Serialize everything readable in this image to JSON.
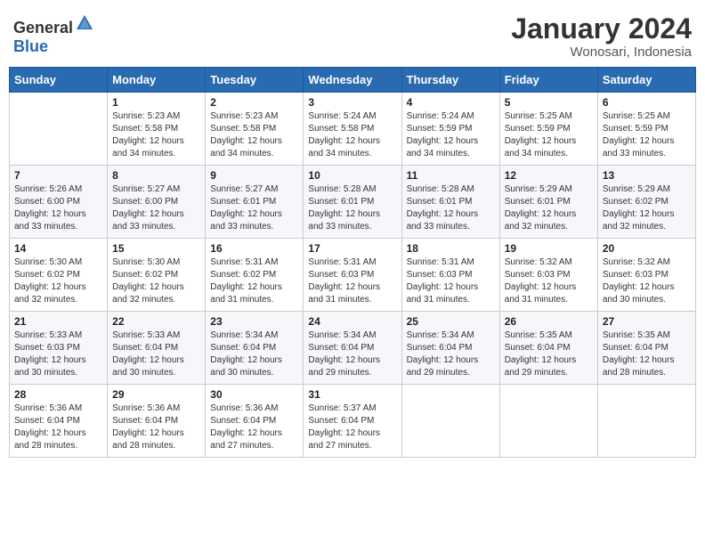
{
  "header": {
    "logo_general": "General",
    "logo_blue": "Blue",
    "month_title": "January 2024",
    "location": "Wonosari, Indonesia"
  },
  "days_of_week": [
    "Sunday",
    "Monday",
    "Tuesday",
    "Wednesday",
    "Thursday",
    "Friday",
    "Saturday"
  ],
  "weeks": [
    [
      {
        "day": "",
        "info": ""
      },
      {
        "day": "1",
        "info": "Sunrise: 5:23 AM\nSunset: 5:58 PM\nDaylight: 12 hours\nand 34 minutes."
      },
      {
        "day": "2",
        "info": "Sunrise: 5:23 AM\nSunset: 5:58 PM\nDaylight: 12 hours\nand 34 minutes."
      },
      {
        "day": "3",
        "info": "Sunrise: 5:24 AM\nSunset: 5:58 PM\nDaylight: 12 hours\nand 34 minutes."
      },
      {
        "day": "4",
        "info": "Sunrise: 5:24 AM\nSunset: 5:59 PM\nDaylight: 12 hours\nand 34 minutes."
      },
      {
        "day": "5",
        "info": "Sunrise: 5:25 AM\nSunset: 5:59 PM\nDaylight: 12 hours\nand 34 minutes."
      },
      {
        "day": "6",
        "info": "Sunrise: 5:25 AM\nSunset: 5:59 PM\nDaylight: 12 hours\nand 33 minutes."
      }
    ],
    [
      {
        "day": "7",
        "info": "Sunrise: 5:26 AM\nSunset: 6:00 PM\nDaylight: 12 hours\nand 33 minutes."
      },
      {
        "day": "8",
        "info": "Sunrise: 5:27 AM\nSunset: 6:00 PM\nDaylight: 12 hours\nand 33 minutes."
      },
      {
        "day": "9",
        "info": "Sunrise: 5:27 AM\nSunset: 6:01 PM\nDaylight: 12 hours\nand 33 minutes."
      },
      {
        "day": "10",
        "info": "Sunrise: 5:28 AM\nSunset: 6:01 PM\nDaylight: 12 hours\nand 33 minutes."
      },
      {
        "day": "11",
        "info": "Sunrise: 5:28 AM\nSunset: 6:01 PM\nDaylight: 12 hours\nand 33 minutes."
      },
      {
        "day": "12",
        "info": "Sunrise: 5:29 AM\nSunset: 6:01 PM\nDaylight: 12 hours\nand 32 minutes."
      },
      {
        "day": "13",
        "info": "Sunrise: 5:29 AM\nSunset: 6:02 PM\nDaylight: 12 hours\nand 32 minutes."
      }
    ],
    [
      {
        "day": "14",
        "info": "Sunrise: 5:30 AM\nSunset: 6:02 PM\nDaylight: 12 hours\nand 32 minutes."
      },
      {
        "day": "15",
        "info": "Sunrise: 5:30 AM\nSunset: 6:02 PM\nDaylight: 12 hours\nand 32 minutes."
      },
      {
        "day": "16",
        "info": "Sunrise: 5:31 AM\nSunset: 6:02 PM\nDaylight: 12 hours\nand 31 minutes."
      },
      {
        "day": "17",
        "info": "Sunrise: 5:31 AM\nSunset: 6:03 PM\nDaylight: 12 hours\nand 31 minutes."
      },
      {
        "day": "18",
        "info": "Sunrise: 5:31 AM\nSunset: 6:03 PM\nDaylight: 12 hours\nand 31 minutes."
      },
      {
        "day": "19",
        "info": "Sunrise: 5:32 AM\nSunset: 6:03 PM\nDaylight: 12 hours\nand 31 minutes."
      },
      {
        "day": "20",
        "info": "Sunrise: 5:32 AM\nSunset: 6:03 PM\nDaylight: 12 hours\nand 30 minutes."
      }
    ],
    [
      {
        "day": "21",
        "info": "Sunrise: 5:33 AM\nSunset: 6:03 PM\nDaylight: 12 hours\nand 30 minutes."
      },
      {
        "day": "22",
        "info": "Sunrise: 5:33 AM\nSunset: 6:04 PM\nDaylight: 12 hours\nand 30 minutes."
      },
      {
        "day": "23",
        "info": "Sunrise: 5:34 AM\nSunset: 6:04 PM\nDaylight: 12 hours\nand 30 minutes."
      },
      {
        "day": "24",
        "info": "Sunrise: 5:34 AM\nSunset: 6:04 PM\nDaylight: 12 hours\nand 29 minutes."
      },
      {
        "day": "25",
        "info": "Sunrise: 5:34 AM\nSunset: 6:04 PM\nDaylight: 12 hours\nand 29 minutes."
      },
      {
        "day": "26",
        "info": "Sunrise: 5:35 AM\nSunset: 6:04 PM\nDaylight: 12 hours\nand 29 minutes."
      },
      {
        "day": "27",
        "info": "Sunrise: 5:35 AM\nSunset: 6:04 PM\nDaylight: 12 hours\nand 28 minutes."
      }
    ],
    [
      {
        "day": "28",
        "info": "Sunrise: 5:36 AM\nSunset: 6:04 PM\nDaylight: 12 hours\nand 28 minutes."
      },
      {
        "day": "29",
        "info": "Sunrise: 5:36 AM\nSunset: 6:04 PM\nDaylight: 12 hours\nand 28 minutes."
      },
      {
        "day": "30",
        "info": "Sunrise: 5:36 AM\nSunset: 6:04 PM\nDaylight: 12 hours\nand 27 minutes."
      },
      {
        "day": "31",
        "info": "Sunrise: 5:37 AM\nSunset: 6:04 PM\nDaylight: 12 hours\nand 27 minutes."
      },
      {
        "day": "",
        "info": ""
      },
      {
        "day": "",
        "info": ""
      },
      {
        "day": "",
        "info": ""
      }
    ]
  ]
}
